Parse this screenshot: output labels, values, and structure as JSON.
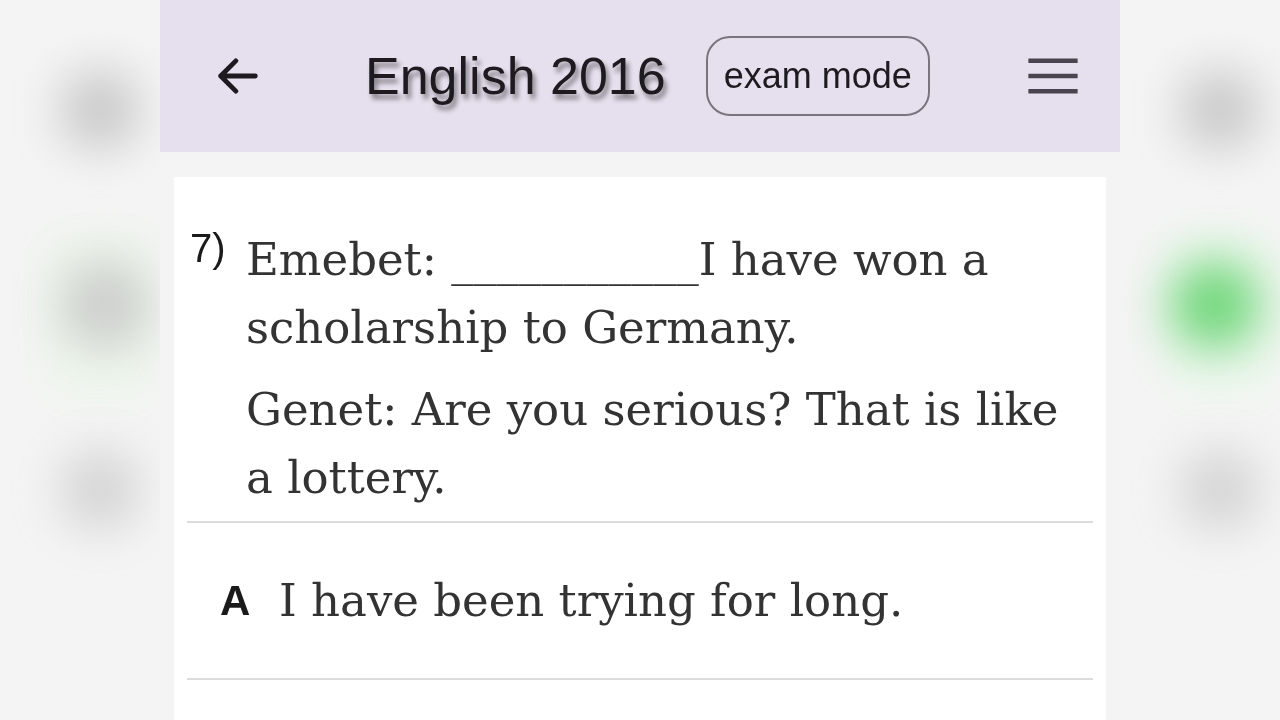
{
  "header": {
    "title": "English 2016",
    "mode_button": "exam mode"
  },
  "question": {
    "number": "7)",
    "paragraphs": [
      "Emebet: ___________I have won a scholarship to Germany.",
      "Genet: Are you serious? That is like a lottery."
    ]
  },
  "options": [
    {
      "letter": "A",
      "text": "I have been trying for long."
    }
  ]
}
